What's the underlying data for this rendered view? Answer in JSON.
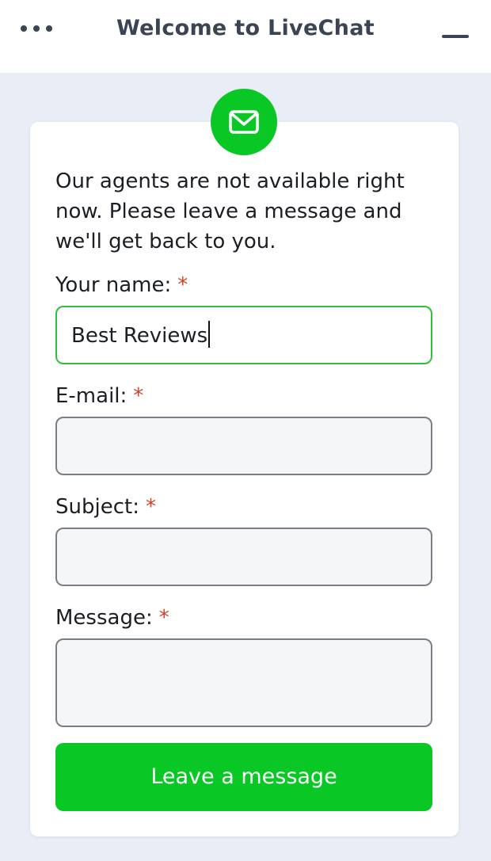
{
  "header": {
    "title": "Welcome to LiveChat"
  },
  "form": {
    "intro": "Our agents are not available right now. Please leave a message and we'll get back to you.",
    "required_marker": "*",
    "fields": {
      "name": {
        "label": "Your name:",
        "value": "Best Reviews"
      },
      "email": {
        "label": "E-mail:",
        "value": ""
      },
      "subject": {
        "label": "Subject:",
        "value": ""
      },
      "message": {
        "label": "Message:",
        "value": ""
      }
    },
    "submit_label": "Leave a message"
  },
  "icons": {
    "menu": "more-dots-icon",
    "minimize": "minimize-icon",
    "badge": "envelope-icon"
  },
  "colors": {
    "brand_green": "#09c725",
    "focus_border": "#2fc13e",
    "required": "#d0432a",
    "header_text": "#3b4452",
    "background": "#e9edf5"
  }
}
